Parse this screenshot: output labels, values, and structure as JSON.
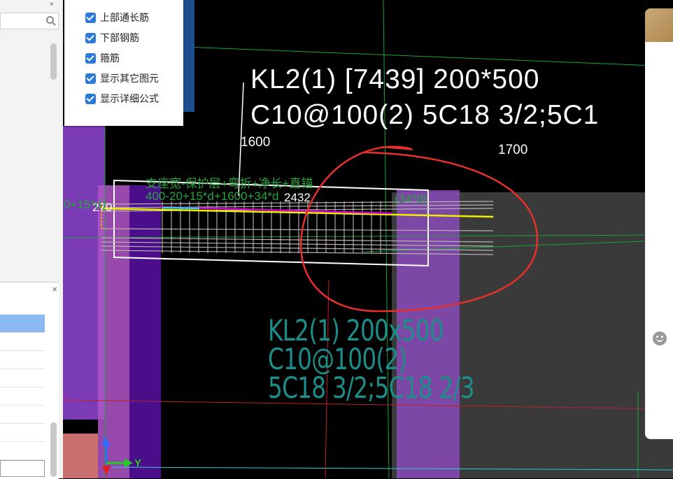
{
  "layer_panel": {
    "items": [
      {
        "label": "上部通长筋",
        "checked": true
      },
      {
        "label": "下部钢筋",
        "checked": true
      },
      {
        "label": "箍筋",
        "checked": true
      },
      {
        "label": "显示其它图元",
        "checked": true
      },
      {
        "label": "显示详细公式",
        "checked": true
      }
    ]
  },
  "left_panel": {
    "close_glyph": "×",
    "collapse_glyph": "»"
  },
  "cad": {
    "beam_title_line1": "KL2(1) [7439] 200*500",
    "beam_title_line2": "C10@100(2) 5C18 3/2;5C1",
    "dim_1600": "1600",
    "dim_1700": "1700",
    "dim_270": "270",
    "dim_2432": "2432",
    "formula_line1": "支座宽-保护层+弯折+净长+直锚",
    "formula_line2": "400-20+15*d+1600+34*d",
    "formula_left": "0+15*d)",
    "formula_right": "(34*d)",
    "annotation_line1": "KL2(1) 200x500",
    "annotation_line2": "C10@100(2)",
    "annotation_line3": "5C18 3/2;5C18 2/3",
    "axis_z": "Z",
    "axis_y": "Y"
  },
  "colors": {
    "checkbox": "#2b79d8",
    "cad_background": "#000000",
    "green_grid": "#19a33a",
    "rebar_magenta": "#d000d0",
    "rebar_yellow": "#f0f000",
    "annotation_cyan": "#1c8e8a",
    "markup_red": "#e8302a",
    "column_purple": "#8a3fc0"
  },
  "icons": {
    "search": "search-icon",
    "close": "close-icon",
    "checkbox": "checkbox-checked-icon",
    "feedback": "smiley-icon",
    "axis": "axis-gizmo-icon"
  }
}
